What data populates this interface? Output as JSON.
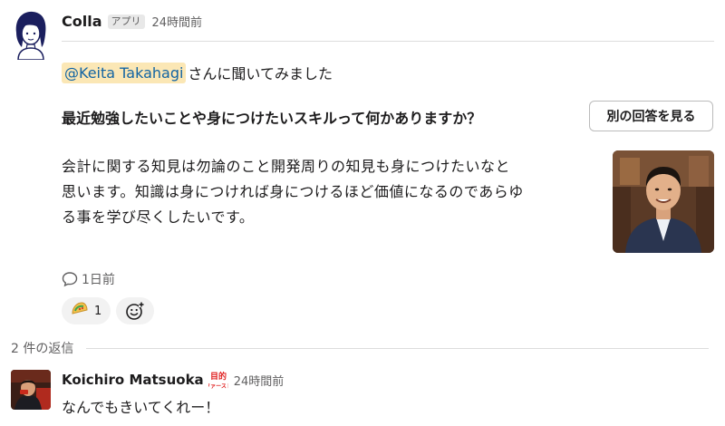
{
  "message": {
    "sender": "Colla",
    "app_badge": "アプリ",
    "timestamp": "24時間前",
    "mention": "@Keita Takahagi",
    "mention_suffix": "さんに聞いてみました",
    "question": "最近勉強したいことや身につけたいスキルって何かありますか？",
    "other_answer_button": "別の回答を見る",
    "answer_lines": [
      "会計に関する知見は勿論のこと開発周りの知見も身につけたいなと",
      "思います。知識は身につければ身につけるほど価値になるのであらゆ",
      "る事を学び尽くしたいです。"
    ],
    "last_reply": "1日前",
    "reaction": {
      "emoji": "taco-emoji",
      "count": "1"
    }
  },
  "thread": {
    "replies_label": "2 件の返信",
    "reply": {
      "sender": "Koichiro Matsuoka",
      "badge_text": "目的ファースト",
      "timestamp": "24時間前",
      "text": "なんでもきいてくれー！"
    }
  },
  "colors": {
    "mention_bg": "#fbe7b5",
    "mention_text": "#1264a3",
    "badge_red": "#e01e1e"
  }
}
